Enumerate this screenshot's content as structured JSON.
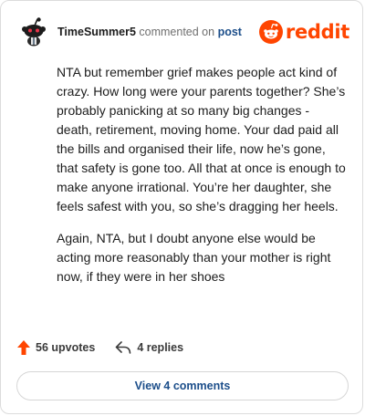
{
  "comment": {
    "username": "TimeSummer5",
    "commented_text": "commented on",
    "post_link": "post",
    "paragraphs": [
      "NTA but remember grief makes people act kind of crazy. How long were your parents together? She’s probably panicking at so many big changes - death, retirement, moving home. Your dad paid all the bills and organised their life, now he’s gone, that safety is gone too. All that at once is enough to make anyone irrational. You’re her daughter, she feels safest with you, so she’s dragging her heels.",
      "Again, NTA, but I doubt anyone else would be acting more reasonably than your mother is right now, if they were in her shoes"
    ]
  },
  "brand": {
    "wordmark": "reddit",
    "color": "#ff4500"
  },
  "actions": {
    "upvotes_label": "56 upvotes",
    "replies_label": "4 replies"
  },
  "footer": {
    "view_comments_label": "View 4 comments"
  },
  "icons": {
    "avatar": "snoo-avatar-icon",
    "logo": "reddit-logo-icon",
    "upvote": "upvote-arrow-icon",
    "reply": "reply-arrow-icon"
  }
}
